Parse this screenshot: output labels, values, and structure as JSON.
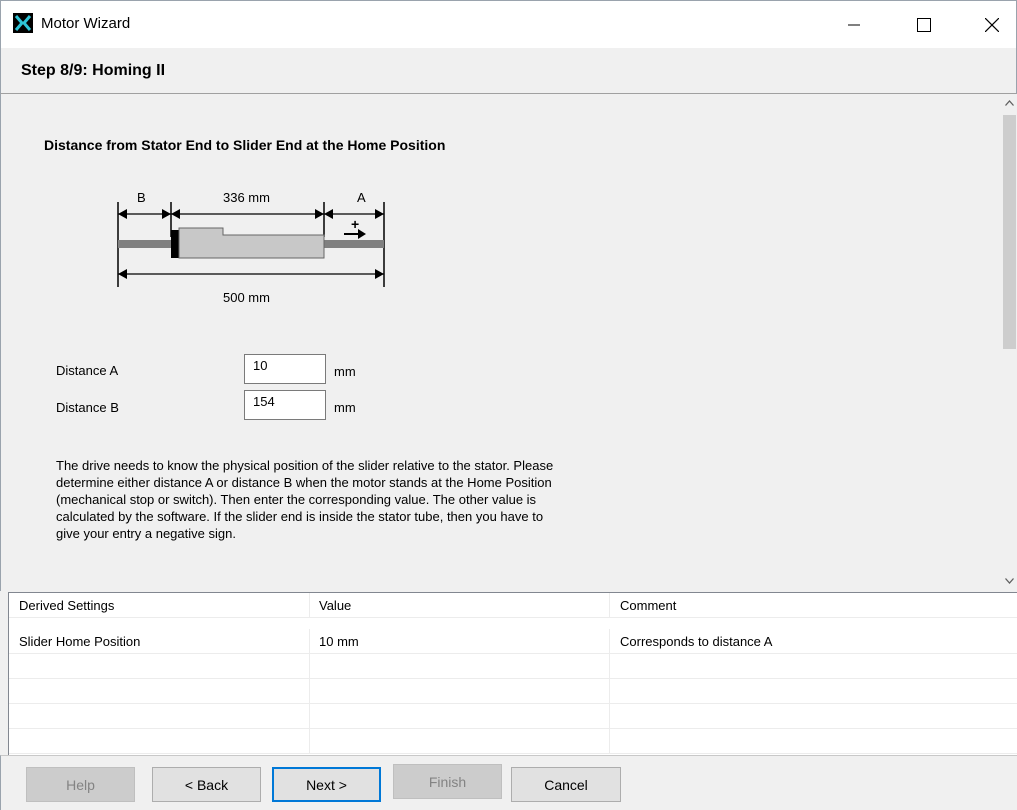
{
  "window": {
    "title": "Motor Wizard",
    "minimize_glyph": "—",
    "maximize_glyph": "☐",
    "close_glyph": "✕"
  },
  "step": {
    "title": "Step 8/9: Homing II"
  },
  "section": {
    "heading": "Distance from Stator End to Slider End at the Home Position"
  },
  "diagram": {
    "label_b": "B",
    "label_stator_length": "336 mm",
    "label_a": "A",
    "label_total": "500 mm",
    "direction_sign": "+"
  },
  "fields": {
    "distance_a": {
      "label": "Distance A",
      "value": "10",
      "unit": "mm"
    },
    "distance_b": {
      "label": "Distance B",
      "value": "154",
      "unit": "mm"
    }
  },
  "description": {
    "line1": "The drive needs to know the physical position of the slider relative to the stator. Please",
    "line2": "determine either distance A or distance B when the motor stands at the Home Position",
    "line3": "(mechanical stop or switch). Then enter the corresponding value. The other value is",
    "line4": "calculated by the software. If the slider end is inside the stator tube, then you have to",
    "line5": "give your entry a negative sign."
  },
  "table": {
    "headers": [
      "Derived Settings",
      "Value",
      "Comment"
    ],
    "rows": [
      [
        "Slider Home Position",
        "10 mm",
        "Corresponds to distance A"
      ],
      [
        "",
        "",
        ""
      ],
      [
        "",
        "",
        ""
      ],
      [
        "",
        "",
        ""
      ],
      [
        "",
        "",
        ""
      ]
    ]
  },
  "buttons": {
    "help": "Help",
    "back": "< Back",
    "next": "Next >",
    "finish": "Finish",
    "cancel": "Cancel"
  },
  "icons": {
    "app": "motor-wizard-logo-icon",
    "scroll_up": "chevron-up-icon",
    "scroll_down": "chevron-down-icon"
  },
  "colors": {
    "accent": "#0078d7",
    "stator_fill": "#c8c8c8",
    "rod": "#808080"
  }
}
